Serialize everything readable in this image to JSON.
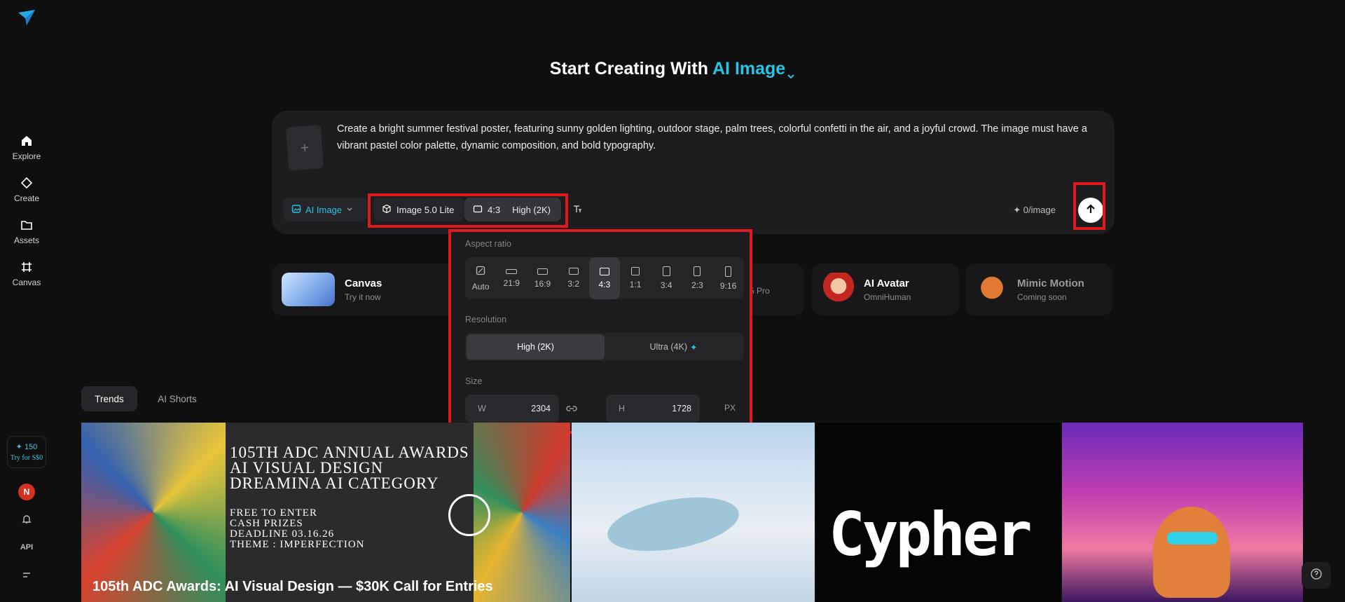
{
  "sidebar": {
    "items": [
      {
        "label": "Explore",
        "icon": "home-icon"
      },
      {
        "label": "Create",
        "icon": "diamond-icon"
      },
      {
        "label": "Assets",
        "icon": "folder-icon"
      },
      {
        "label": "Canvas",
        "icon": "canvas-icon"
      }
    ],
    "credits": "✦ 150",
    "try_label": "Try for S$0",
    "avatar_initial": "N",
    "api_label": "API"
  },
  "header": {
    "title_prefix": "Start Creating With",
    "title_accent": "AI Image"
  },
  "prompt": {
    "text": "Create a bright summer festival poster, featuring sunny golden lighting, outdoor stage, palm trees, colorful confetti in the air, and a joyful crowd. The image must have a vibrant pastel color palette, dynamic composition, and bold typography.",
    "upload_symbol": "+",
    "mode_label": "AI Image",
    "model_label": "Image 5.0 Lite",
    "ratio_label": "4:3",
    "resolution_label": "High (2K)",
    "cost_label": "✦ 0/image"
  },
  "popup": {
    "aspect_label": "Aspect ratio",
    "ratios": [
      "Auto",
      "21:9",
      "16:9",
      "3:2",
      "4:3",
      "1:1",
      "3:4",
      "2:3",
      "9:16"
    ],
    "selected_ratio": "4:3",
    "resolution_label": "Resolution",
    "resolutions": [
      "High (2K)",
      "Ultra (4K)"
    ],
    "selected_resolution": "High (2K)",
    "size_label": "Size",
    "width_key": "W",
    "width_value": "2304",
    "height_key": "H",
    "height_value": "1728",
    "unit": "PX"
  },
  "features": [
    {
      "title": "Canvas",
      "subtitle": "Try it now"
    },
    {
      "title": "",
      "subtitle": "5 Pro"
    },
    {
      "title": "AI Avatar",
      "subtitle": "OmniHuman"
    },
    {
      "title": "Mimic Motion",
      "subtitle": "Coming soon"
    }
  ],
  "tabs": [
    "Trends",
    "AI Shorts"
  ],
  "gallery": {
    "poster_lines": [
      "105TH ADC ANNUAL AWARDS",
      "AI VISUAL DESIGN",
      "DREAMINA AI CATEGORY"
    ],
    "poster_small": [
      "FREE TO ENTER",
      "CASH PRIZES",
      "DEADLINE 03.16.26",
      "THEME : IMPERFECTION"
    ],
    "caption": "105th ADC Awards: AI Visual Design — $30K Call for Entries",
    "cypher_text": "Cypher"
  },
  "colors": {
    "accent": "#29c3e6",
    "highlight": "#e0191f",
    "background": "#0f0f10"
  }
}
